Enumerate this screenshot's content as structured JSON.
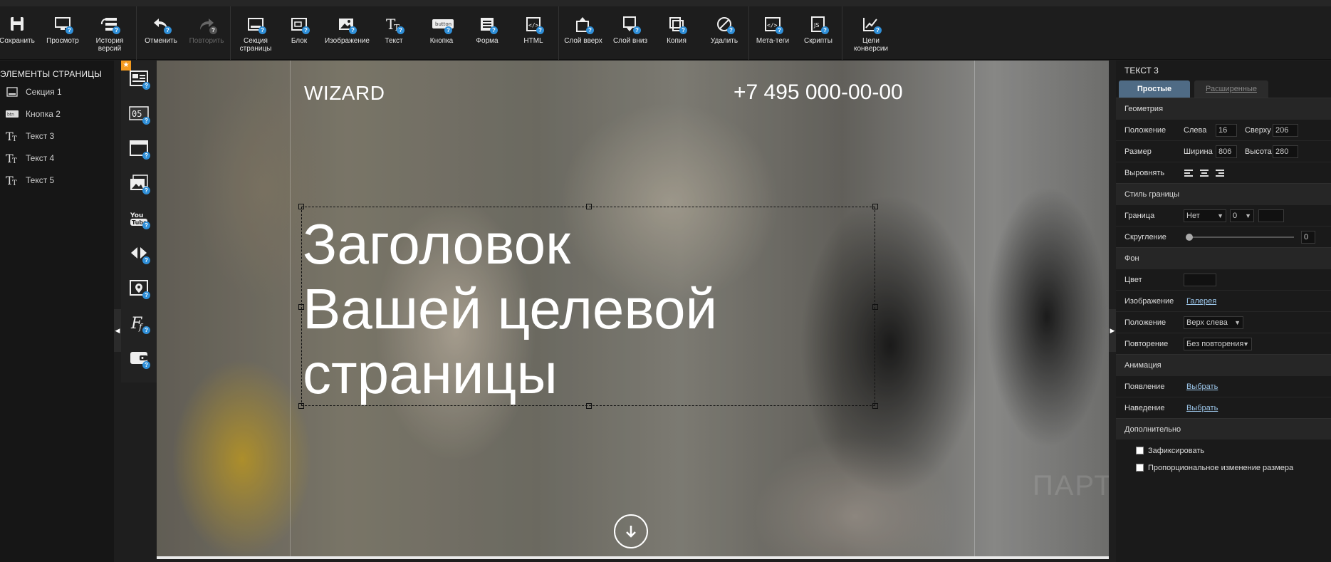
{
  "toolbar": {
    "buttons": [
      {
        "label": "Сохранить",
        "icon": "save-icon"
      },
      {
        "label": "Просмотр",
        "icon": "monitor-icon"
      },
      {
        "label": "История версий",
        "icon": "history-icon"
      },
      {
        "label": "Отменить",
        "icon": "undo-icon"
      },
      {
        "label": "Повторить",
        "icon": "redo-icon"
      },
      {
        "label": "Секция страницы",
        "icon": "section-icon"
      },
      {
        "label": "Блок",
        "icon": "block-icon"
      },
      {
        "label": "Изображение",
        "icon": "image-icon"
      },
      {
        "label": "Текст",
        "icon": "text-icon"
      },
      {
        "label": "Кнопка",
        "icon": "button-icon",
        "badge": "button"
      },
      {
        "label": "Форма",
        "icon": "form-icon"
      },
      {
        "label": "HTML",
        "icon": "html-icon"
      },
      {
        "label": "Слой вверх",
        "icon": "layer-up-icon"
      },
      {
        "label": "Слой вниз",
        "icon": "layer-down-icon"
      },
      {
        "label": "Копия",
        "icon": "copy-icon"
      },
      {
        "label": "Удалить",
        "icon": "delete-icon"
      },
      {
        "label": "Мета-теги",
        "icon": "meta-icon"
      },
      {
        "label": "Скрипты",
        "icon": "script-icon"
      },
      {
        "label": "Цели конверсии",
        "icon": "conversion-icon"
      }
    ]
  },
  "left_panel": {
    "title": "ЭЛЕМЕНТЫ СТРАНИЦЫ",
    "items": [
      {
        "label": "Секция 1",
        "icon": "section-icon"
      },
      {
        "label": "Кнопка 2",
        "icon": "button-icon",
        "badge": "btn"
      },
      {
        "label": "Текст 3",
        "icon": "text-icon"
      },
      {
        "label": "Текст 4",
        "icon": "text-icon"
      },
      {
        "label": "Текст 5",
        "icon": "text-icon"
      }
    ]
  },
  "widgets": {
    "star": "★",
    "counter_label": "05",
    "youtube_label": "You Tube"
  },
  "canvas": {
    "brand": "WIZARD",
    "phone": "+7 495 000-00-00",
    "headline_lines": [
      "Заголовок",
      "Вашей целевой",
      "страницы"
    ],
    "watermark": "ПАРТНЕРКИН"
  },
  "right_panel": {
    "title": "ТЕКСТ 3",
    "tabs": {
      "simple": "Простые",
      "advanced": "Расширенные"
    },
    "geometry": {
      "head": "Геометрия",
      "position_label": "Положение",
      "left_label": "Слева",
      "left_value": "16",
      "top_label": "Сверху",
      "top_value": "206",
      "size_label": "Размер",
      "width_label": "Ширина",
      "width_value": "806",
      "height_label": "Высота",
      "height_value": "280",
      "align_label": "Выровнять"
    },
    "border": {
      "head": "Стиль границы",
      "border_label": "Граница",
      "border_value": "Нет",
      "border_width": "0",
      "radius_label": "Скругление",
      "radius_value": "0"
    },
    "background": {
      "head": "Фон",
      "color_label": "Цвет",
      "image_label": "Изображение",
      "image_link": "Галерея",
      "position_label": "Положение",
      "position_value": "Верх слева",
      "repeat_label": "Повторение",
      "repeat_value": "Без повторения"
    },
    "animation": {
      "head": "Анимация",
      "appear_label": "Появление",
      "appear_link": "Выбрать",
      "hover_label": "Наведение",
      "hover_link": "Выбрать"
    },
    "extra": {
      "head": "Дополнительно",
      "fix_label": "Зафиксировать",
      "proportional_label": "Пропорциональное изменение размера"
    }
  },
  "colors": {
    "accent_tab": "#4f6b85",
    "help_badge": "#2f8fd8",
    "link": "#9cc6ea",
    "star_badge": "#f39a1f"
  }
}
